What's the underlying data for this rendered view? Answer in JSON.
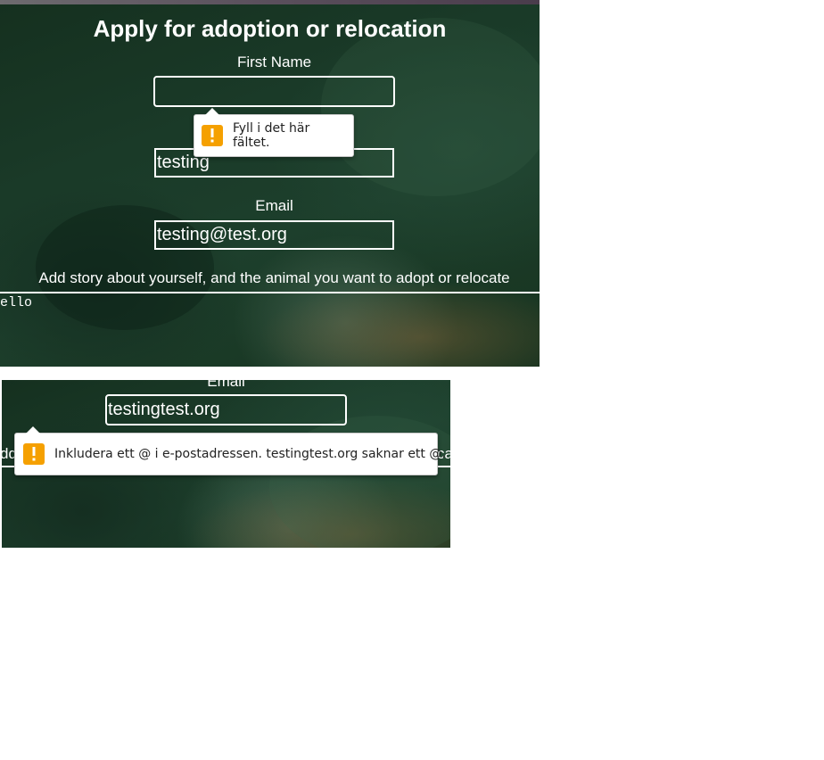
{
  "form": {
    "title": "Apply for adoption or relocation",
    "first_name_label": "First Name",
    "first_name_value": "",
    "last_name_value": "testing",
    "email_label": "Email",
    "email_value": "testing@test.org",
    "story_label": "Add story about yourself, and the animal you want to adopt or relocate",
    "story_value": "ello"
  },
  "tooltip_required": {
    "icon": "warning-icon",
    "text": "Fyll i det här fältet."
  },
  "second_screenshot": {
    "email_label": "Email",
    "email_value": "testingtest.org",
    "story_label_left_fragment": "dd",
    "story_label_right_fragment": "ca",
    "tooltip": {
      "icon": "warning-icon",
      "text": "Inkludera ett @ i e-postadressen. testingtest.org saknar ett @."
    }
  },
  "colors": {
    "warning": "#f5a000",
    "field_border": "#ffffff",
    "text": "#ffffff"
  }
}
